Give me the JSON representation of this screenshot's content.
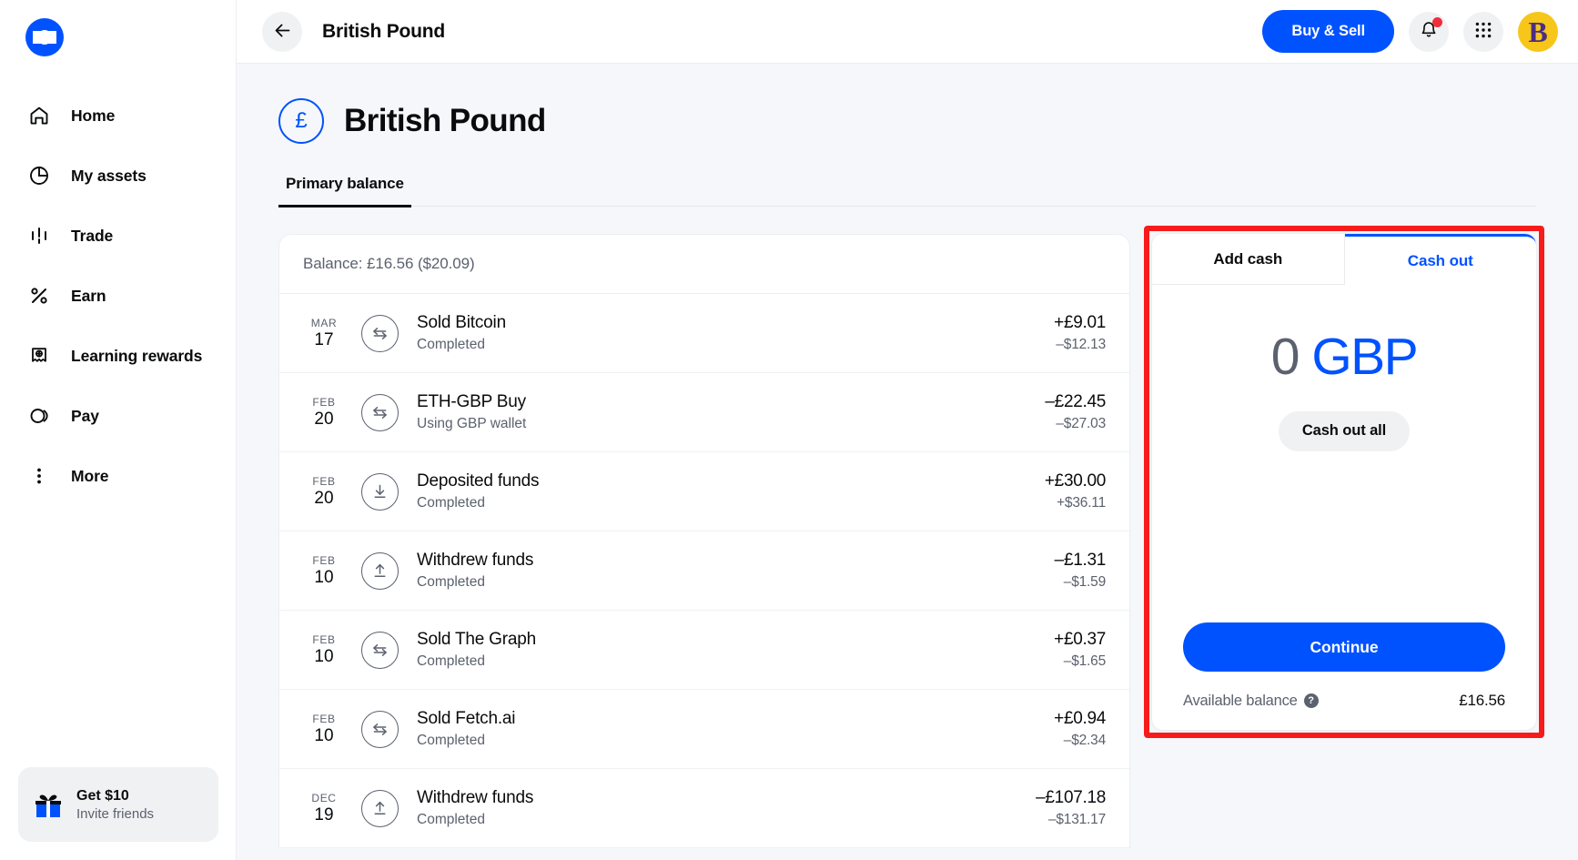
{
  "sidebar": {
    "logo_name": "coinbase-logo",
    "items": [
      {
        "label": "Home",
        "icon": "home-icon"
      },
      {
        "label": "My assets",
        "icon": "pie-chart-icon"
      },
      {
        "label": "Trade",
        "icon": "candlestick-icon"
      },
      {
        "label": "Earn",
        "icon": "percent-icon"
      },
      {
        "label": "Learning rewards",
        "icon": "badge-icon"
      },
      {
        "label": "Pay",
        "icon": "pay-icon"
      },
      {
        "label": "More",
        "icon": "more-vertical-icon"
      }
    ],
    "promo": {
      "title": "Get $10",
      "subtitle": "Invite friends",
      "icon": "gift-icon"
    }
  },
  "topbar": {
    "back_icon": "arrow-left-icon",
    "title": "British Pound",
    "buy_sell_label": "Buy & Sell",
    "notifications_icon": "bell-icon",
    "apps_icon": "grid-apps-icon",
    "avatar_label": "B"
  },
  "asset": {
    "symbol": "£",
    "name": "British Pound"
  },
  "tabs": [
    {
      "label": "Primary balance",
      "active": true
    }
  ],
  "transactions": {
    "balance_line": "Balance: £16.56 ($20.09)",
    "rows": [
      {
        "month": "MAR",
        "day": "17",
        "icon": "swap-icon",
        "title": "Sold Bitcoin",
        "sub": "Completed",
        "amount": "+£9.01",
        "fiat": "–$12.13"
      },
      {
        "month": "FEB",
        "day": "20",
        "icon": "swap-icon",
        "title": "ETH-GBP Buy",
        "sub": "Using GBP wallet",
        "amount": "–£22.45",
        "fiat": "–$27.03"
      },
      {
        "month": "FEB",
        "day": "20",
        "icon": "download-icon",
        "title": "Deposited funds",
        "sub": "Completed",
        "amount": "+£30.00",
        "fiat": "+$36.11"
      },
      {
        "month": "FEB",
        "day": "10",
        "icon": "upload-icon",
        "title": "Withdrew funds",
        "sub": "Completed",
        "amount": "–£1.31",
        "fiat": "–$1.59"
      },
      {
        "month": "FEB",
        "day": "10",
        "icon": "swap-icon",
        "title": "Sold The Graph",
        "sub": "Completed",
        "amount": "+£0.37",
        "fiat": "–$1.65"
      },
      {
        "month": "FEB",
        "day": "10",
        "icon": "swap-icon",
        "title": "Sold Fetch.ai",
        "sub": "Completed",
        "amount": "+£0.94",
        "fiat": "–$2.34"
      },
      {
        "month": "DEC",
        "day": "19",
        "icon": "upload-icon",
        "title": "Withdrew funds",
        "sub": "Completed",
        "amount": "–£107.18",
        "fiat": "–$131.17"
      }
    ]
  },
  "cash_panel": {
    "tab_add_cash": "Add cash",
    "tab_cash_out": "Cash out",
    "amount_value": "0",
    "amount_currency": "GBP",
    "cash_out_all_label": "Cash out all",
    "continue_label": "Continue",
    "available_label": "Available balance",
    "available_help_glyph": "?",
    "available_value": "£16.56",
    "highlight_color": "#f71b1b",
    "accent_color": "#0052FF"
  }
}
